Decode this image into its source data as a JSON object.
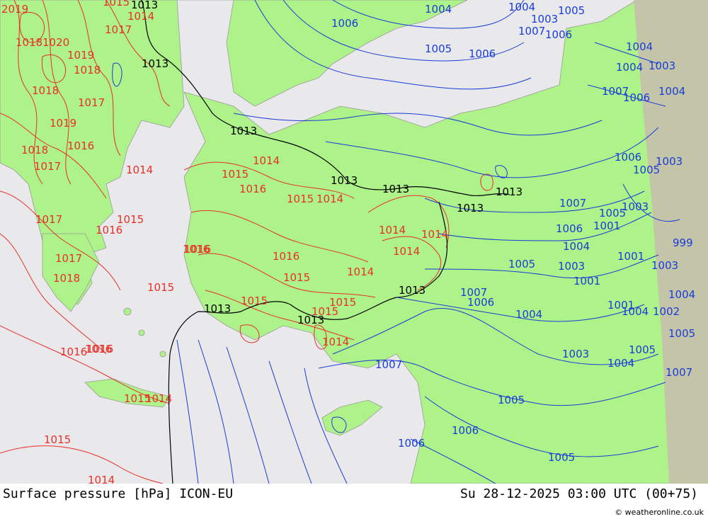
{
  "footer": {
    "title": "Surface pressure [hPa] ICON-EU",
    "datetime": "Su 28-12-2025 03:00 UTC (00+75)",
    "credit": "© weatheronline.co.uk"
  },
  "colors": {
    "land": "#aef28a",
    "sea": "#e9e9eb",
    "outside_domain": "#c4c4a8",
    "isobar_high": "#e8302a",
    "isobar_low": "#1a3cd8",
    "isobar_ref": "#000000",
    "coast": "#9a9a9a"
  },
  "labels_black": [
    "1013",
    "1013",
    "1013",
    "1013",
    "1013",
    "1013",
    "1013",
    "1013",
    "1013",
    "1013"
  ],
  "labels_red": [
    "2019",
    "1015",
    "1014",
    "1017",
    "1020",
    "1018",
    "1019",
    "1018",
    "1018",
    "1017",
    "1019",
    "1018",
    "1017",
    "1016",
    "1017",
    "1014",
    "1015",
    "1016",
    "1016",
    "1015",
    "1015",
    "1014",
    "1015",
    "1016",
    "1016",
    "1015",
    "1014",
    "1014",
    "1014",
    "1014",
    "1015",
    "1015",
    "1016",
    "1016",
    "1014",
    "1015",
    "1017",
    "1018",
    "1016",
    "1016",
    "1015",
    "1014",
    "1015",
    "1014",
    "1014"
  ],
  "labels_blue": [
    "1004",
    "1006",
    "1005",
    "1006",
    "1004",
    "1005",
    "1003",
    "1007",
    "1006",
    "1004",
    "1004",
    "1003",
    "1007",
    "1006",
    "1004",
    "1006",
    "1005",
    "1003",
    "1007",
    "1005",
    "1006",
    "1001",
    "1004",
    "1005",
    "1003",
    "1001",
    "1003",
    "1007",
    "1006",
    "1004",
    "1003",
    "1004",
    "1002",
    "1003",
    "1005",
    "1004",
    "1007",
    "1005",
    "1006",
    "1006",
    "1005",
    "1001",
    "1001",
    "1007",
    "1004",
    "1005",
    "999"
  ]
}
